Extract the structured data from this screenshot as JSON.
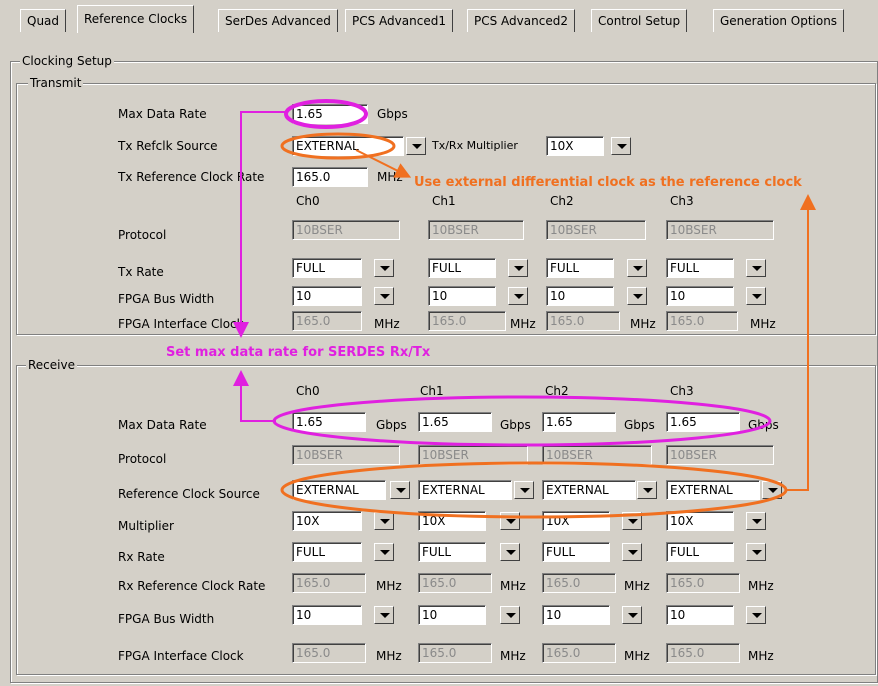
{
  "tabs": [
    "Quad",
    "Reference Clocks",
    "SerDes Advanced",
    "PCS Advanced1",
    "PCS Advanced2",
    "Control Setup",
    "Generation Options"
  ],
  "clocking_setup": {
    "title": "Clocking Setup",
    "transmit": {
      "title": "Transmit",
      "max_data_rate_label": "Max Data Rate",
      "max_data_rate_value": "1.65",
      "max_data_rate_unit": "Gbps",
      "refclk_source_label": "Tx Refclk Source",
      "refclk_source_value": "EXTERNAL",
      "multiplier_label": "Tx/Rx Multiplier",
      "multiplier_value": "10X",
      "ref_clock_rate_label": "Tx Reference Clock Rate",
      "ref_clock_rate_value": "165.0",
      "ref_clock_rate_unit": "MHz",
      "channels": [
        "Ch0",
        "Ch1",
        "Ch2",
        "Ch3"
      ],
      "protocol_label": "Protocol",
      "protocol_values": [
        "10BSER",
        "10BSER",
        "10BSER",
        "10BSER"
      ],
      "tx_rate_label": "Tx Rate",
      "tx_rate_values": [
        "FULL",
        "FULL",
        "FULL",
        "FULL"
      ],
      "bus_width_label": "FPGA Bus Width",
      "bus_width_values": [
        "10",
        "10",
        "10",
        "10"
      ],
      "interface_clock_label": "FPGA Interface Clock",
      "interface_clock_values": [
        "165.0",
        "165.0",
        "165.0",
        "165.0"
      ],
      "unit_mhz": "MHz"
    },
    "receive": {
      "title": "Receive",
      "channels": [
        "Ch0",
        "Ch1",
        "Ch2",
        "Ch3"
      ],
      "max_data_rate_label": "Max Data Rate",
      "max_data_rate_values": [
        "1.65",
        "1.65",
        "1.65",
        "1.65"
      ],
      "unit_gbps": "Gbps",
      "protocol_label": "Protocol",
      "protocol_values": [
        "10BSER",
        "10BSER",
        "10BSER",
        "10BSER"
      ],
      "ref_clock_source_label": "Reference Clock Source",
      "ref_clock_source_values": [
        "EXTERNAL",
        "EXTERNAL",
        "EXTERNAL",
        "EXTERNAL"
      ],
      "multiplier_label": "Multiplier",
      "multiplier_values": [
        "10X",
        "10X",
        "10X",
        "10X"
      ],
      "rx_rate_label": "Rx Rate",
      "rx_rate_values": [
        "FULL",
        "FULL",
        "FULL",
        "FULL"
      ],
      "rx_ref_clock_rate_label": "Rx Reference Clock Rate",
      "rx_ref_clock_rate_values": [
        "165.0",
        "165.0",
        "165.0",
        "165.0"
      ],
      "bus_width_label": "FPGA Bus Width",
      "bus_width_values": [
        "10",
        "10",
        "10",
        "10"
      ],
      "interface_clock_label": "FPGA Interface Clock",
      "interface_clock_values": [
        "165.0",
        "165.0",
        "165.0",
        "165.0"
      ],
      "unit_mhz": "MHz"
    }
  },
  "annotations": {
    "ext_clock_note": "Use external differential clock as the reference clock",
    "max_rate_note": "Set max data rate for SERDES Rx/Tx"
  },
  "colors": {
    "orange": "#f07020",
    "magenta": "#e020e0",
    "panel_bg": "#d4d0c8"
  }
}
